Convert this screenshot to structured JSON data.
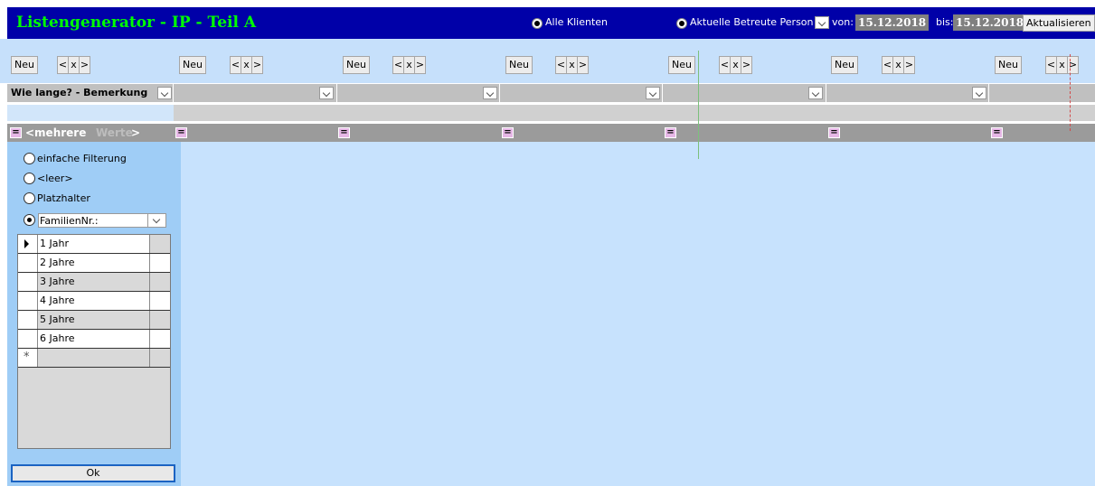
{
  "window": {
    "title": "Listengenerator - IP - Teil A"
  },
  "top": {
    "option_all": "Alle Klienten",
    "option_current": "Aktuelle Betreute Person",
    "from_label": "von:",
    "from_date": "15.12.2018",
    "to_label": "bis:",
    "to_date": "15.12.2018",
    "refresh_label": "Aktualisieren"
  },
  "columns": [
    {
      "new_label": "Neu",
      "prev": "<",
      "delete": "x",
      "next": ">"
    },
    {
      "new_label": "Neu",
      "prev": "<",
      "delete": "x",
      "next": ">"
    },
    {
      "new_label": "Neu",
      "prev": "<",
      "delete": "x",
      "next": ">"
    },
    {
      "new_label": "Neu",
      "prev": "<",
      "delete": "x",
      "next": ">"
    },
    {
      "new_label": "Neu",
      "prev": "<",
      "delete": "x",
      "next": ">"
    },
    {
      "new_label": "Neu",
      "prev": "<",
      "delete": "x",
      "next": ">"
    },
    {
      "new_label": "Neu",
      "prev": "<",
      "delete": "x",
      "next": ">"
    }
  ],
  "header": {
    "field_label": "Wie lange? - Bemerkung"
  },
  "filter": {
    "eq": "=",
    "multi_a": "<mehrere",
    "multi_b": "Werte",
    "multi_c": ">"
  },
  "panel": {
    "opt_simple": "einfache Filterung",
    "opt_empty": "<leer>",
    "opt_placeholder": "Platzhalter",
    "opt_family": "FamilienNr.:",
    "rows": [
      "1 Jahr",
      "2 Jahre",
      "3 Jahre",
      "4 Jahre",
      "5 Jahre",
      "6 Jahre"
    ],
    "new_row_marker": "*",
    "ok_label": "Ok"
  },
  "colors": {
    "title_bg": "#0000a8",
    "title_fg": "#00ff00",
    "area_bg": "#c7e2fd"
  }
}
